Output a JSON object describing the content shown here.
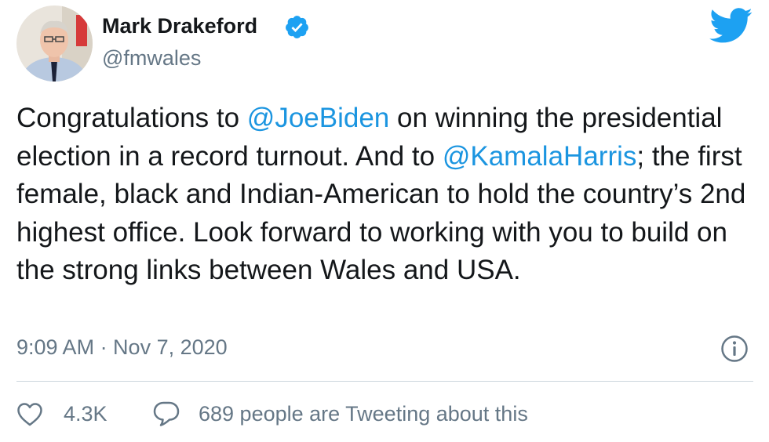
{
  "author": {
    "name": "Mark Drakeford",
    "handle": "@fmwales",
    "verified": true
  },
  "tweet": {
    "segments": [
      {
        "type": "text",
        "text": "Congratulations to "
      },
      {
        "type": "mention",
        "text": "@JoeBiden"
      },
      {
        "type": "text",
        "text": " on winning the presidential election in a record turnout. And to "
      },
      {
        "type": "mention",
        "text": "@KamalaHarris"
      },
      {
        "type": "text",
        "text": "; the first female, black and Indian-American to hold the country’s 2nd highest office. Look forward to working with you to build on the strong links between Wales and USA."
      }
    ],
    "timestamp": "9:09 AM · Nov 7, 2020"
  },
  "engagement": {
    "likes": "4.3K",
    "tweeting": "689 people are Tweeting about this"
  },
  "icons": {
    "bird": "twitter-bird-icon",
    "verified": "verified-badge-icon",
    "info": "info-icon",
    "like": "heart-icon",
    "reply": "speech-bubble-icon"
  },
  "colors": {
    "accent": "#1da1f2",
    "mention": "#1b95e0",
    "text": "#14171a",
    "secondary": "#657786",
    "divider": "#ccd6dd"
  }
}
